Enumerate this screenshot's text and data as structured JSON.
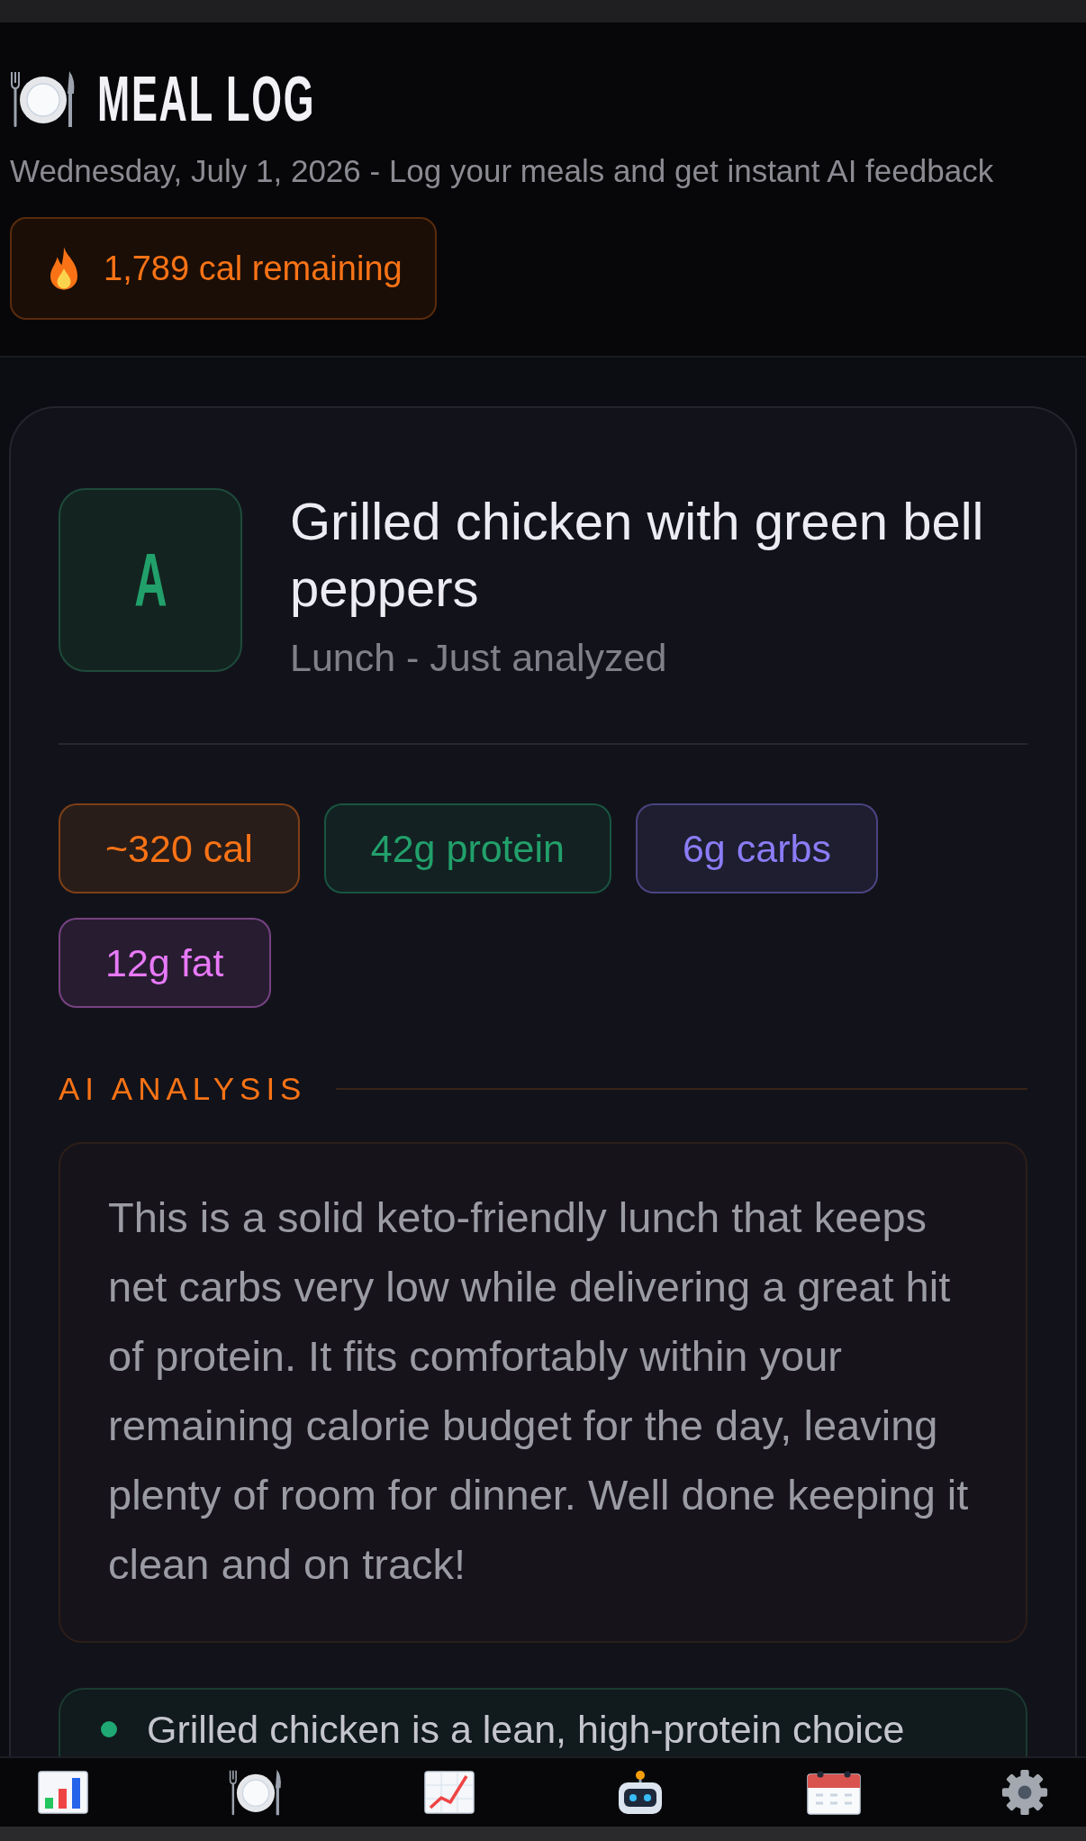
{
  "header": {
    "title": "MEAL LOG",
    "subtitle": "Wednesday, July 1, 2026 - Log your meals and get instant AI feedback",
    "calories_badge": "1,789 cal remaining"
  },
  "meal_card": {
    "grade": "A",
    "title": "Grilled chicken with green bell peppers",
    "meta": "Lunch - Just analyzed",
    "macros": [
      {
        "label": "~320 cal",
        "color": "#f97316"
      },
      {
        "label": "42g protein",
        "color": "#22a06b"
      },
      {
        "label": "6g carbs",
        "color": "#8b7cf6"
      },
      {
        "label": "12g fat",
        "color": "#e879f9"
      }
    ],
    "analysis_heading": "AI ANALYSIS",
    "analysis_text": "This is a solid keto-friendly lunch that keeps net carbs very low while delivering a great hit of protein. It fits comfortably within your remaining calorie budget for the day, leaving plenty of room for dinner. Well done keeping it clean and on track!",
    "insights": [
      {
        "text": "Grilled chicken is a lean, high-protein choice"
      }
    ]
  }
}
